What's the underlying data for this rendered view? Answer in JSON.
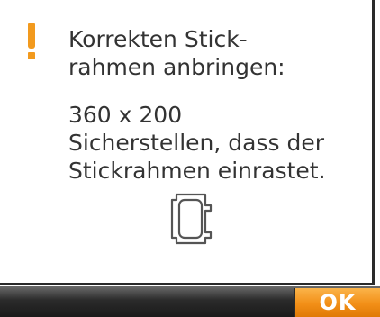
{
  "dialog": {
    "title": "Korrekten Stick-\nrahmen anbringen:",
    "message_lines": [
      "360 x 200",
      "Sicherstellen, dass der",
      "Stickrahmen einrastet."
    ],
    "icon": "warning-exclamation-icon",
    "hoop_icon": "embroidery-hoop-icon"
  },
  "buttons": {
    "ok_label": "OK"
  },
  "colors": {
    "accent": "#f29a1e",
    "text": "#333333",
    "bar": "#2b2b2b"
  }
}
